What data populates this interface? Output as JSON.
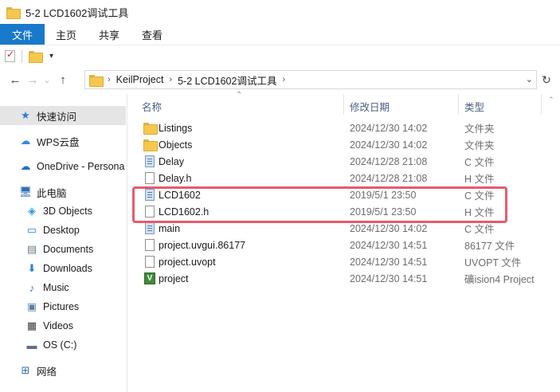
{
  "window": {
    "title": "5-2 LCD1602调试工具"
  },
  "ribbon": {
    "tabs": [
      "文件",
      "主页",
      "共享",
      "查看"
    ]
  },
  "address": {
    "crumbs": [
      "KeilProject",
      "5-2 LCD1602调试工具"
    ]
  },
  "icons": {
    "back": "←",
    "forward": "→",
    "dropdown": "⌄",
    "up": "↑",
    "refresh": "↻",
    "chevron": "›",
    "sort_up": "⌃",
    "caret": "▾",
    "quick_access": "★",
    "cloud": "☁",
    "onedrive": "☁",
    "pc": "🖥",
    "objects3d": "◈",
    "desktop": "▭",
    "documents": "▤",
    "downloads": "⬇",
    "music": "♪",
    "pictures": "▣",
    "videos": "▦",
    "drive": "▬",
    "network": "⊞",
    "uvision": "V"
  },
  "nav": {
    "items": [
      {
        "label": "快速访问",
        "icon": "star-icon"
      },
      {
        "label": "WPS云盘",
        "icon": "cloud-icon"
      },
      {
        "label": "OneDrive - Persona",
        "icon": "onedrive-icon"
      },
      {
        "label": "此电脑",
        "icon": "computer-icon"
      },
      {
        "label": "3D Objects",
        "icon": "3d-objects-icon"
      },
      {
        "label": "Desktop",
        "icon": "desktop-icon"
      },
      {
        "label": "Documents",
        "icon": "documents-icon"
      },
      {
        "label": "Downloads",
        "icon": "downloads-icon"
      },
      {
        "label": "Music",
        "icon": "music-icon"
      },
      {
        "label": "Pictures",
        "icon": "pictures-icon"
      },
      {
        "label": "Videos",
        "icon": "videos-icon"
      },
      {
        "label": "OS (C:)",
        "icon": "drive-icon"
      },
      {
        "label": "网络",
        "icon": "network-icon"
      }
    ]
  },
  "columns": {
    "name": "名称",
    "date": "修改日期",
    "type": "类型"
  },
  "files": [
    {
      "name": "Listings",
      "date": "2024/12/30 14:02",
      "type": "文件夹",
      "icon": "folder-icon"
    },
    {
      "name": "Objects",
      "date": "2024/12/30 14:02",
      "type": "文件夹",
      "icon": "folder-icon"
    },
    {
      "name": "Delay",
      "date": "2024/12/28 21:08",
      "type": "C 文件",
      "icon": "c-file-icon"
    },
    {
      "name": "Delay.h",
      "date": "2024/12/28 21:08",
      "type": "H 文件",
      "icon": "h-file-icon"
    },
    {
      "name": "LCD1602",
      "date": "2019/5/1 23:50",
      "type": "C 文件",
      "icon": "c-file-icon"
    },
    {
      "name": "LCD1602.h",
      "date": "2019/5/1 23:50",
      "type": "H 文件",
      "icon": "h-file-icon"
    },
    {
      "name": "main",
      "date": "2024/12/30 14:02",
      "type": "C 文件",
      "icon": "c-file-icon"
    },
    {
      "name": "project.uvgui.86177",
      "date": "2024/12/30 14:51",
      "type": "86177 文件",
      "icon": "generic-file-icon"
    },
    {
      "name": "project.uvopt",
      "date": "2024/12/30 14:51",
      "type": "UVOPT 文件",
      "icon": "generic-file-icon"
    },
    {
      "name": "project",
      "date": "2024/12/30 14:51",
      "type": "礦ision4 Project",
      "icon": "uvision-project-icon"
    }
  ],
  "colors": {
    "accent": "#1979ca",
    "highlight": "#e85a6c",
    "header_text": "#4d6082"
  }
}
